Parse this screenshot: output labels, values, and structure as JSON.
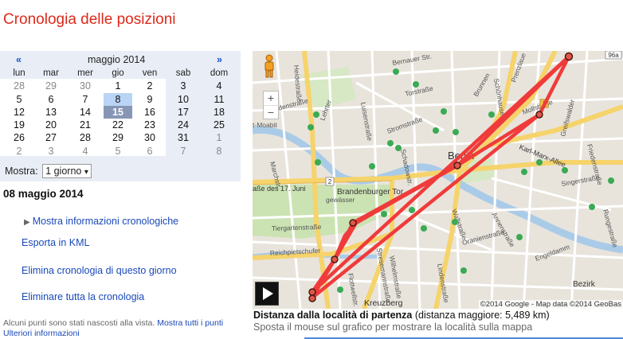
{
  "page": {
    "title": "Cronologia delle posizioni"
  },
  "calendar": {
    "prev": "«",
    "next": "»",
    "month": "maggio 2014",
    "weekdays": [
      "lun",
      "mar",
      "mer",
      "gio",
      "ven",
      "sab",
      "dom"
    ],
    "weeks": [
      [
        "28",
        "29",
        "30",
        "1",
        "2",
        "3",
        "4"
      ],
      [
        "5",
        "6",
        "7",
        "8",
        "9",
        "10",
        "11"
      ],
      [
        "12",
        "13",
        "14",
        "15",
        "16",
        "17",
        "18"
      ],
      [
        "19",
        "20",
        "21",
        "22",
        "23",
        "24",
        "25"
      ],
      [
        "26",
        "27",
        "28",
        "29",
        "30",
        "31",
        "1"
      ],
      [
        "2",
        "3",
        "4",
        "5",
        "6",
        "7",
        "8"
      ]
    ],
    "selected_day": "8",
    "today": "15"
  },
  "mode": {
    "label": "Mostra:",
    "value": "1 giorno",
    "arrow": "▾"
  },
  "date_heading": "08 maggio 2014",
  "links": {
    "show_info": "Mostra informazioni cronologiche",
    "export_kml": "Esporta in KML",
    "delete_day": "Elimina cronologia di questo giorno",
    "delete_all": "Eliminare tutta la cronologia"
  },
  "footnote": {
    "text": "Alcuni punti sono stati nascosti alla vista.",
    "show_all": "Mostra tutti i punti",
    "more_info": "Ulteriori informazioni"
  },
  "map": {
    "copyright": "©2014 Google - Map data ©2014 GeoBas",
    "labels": {
      "berlin": "Berlin",
      "brandenburger_tor": "Brandenburger Tor",
      "str_17_juni": "aße des 17. Juni",
      "karl_marx": "Karl-Marx-Allee",
      "kreuzberg": "Kreuzberg",
      "luisenstrasse": "Luisenstraße",
      "torstrasse": "Torstraße",
      "prenzlauer": "Prenzlaue",
      "moabit": "t-Moabit",
      "bezirk": "Bezirk",
      "oranienstrasse": "Oranienstraße",
      "engeldamm": "Engeldamm",
      "annenstrasse": "Annenstraße",
      "tiergartenstrasse": "Tiergartenstraße",
      "reichpietschufer": "Reichpietschufer",
      "wilhelmstrasse": "Wilhelmstraße",
      "gewasser": "gewässer",
      "road_2": "2",
      "road_96a": "96a",
      "road_1": "1",
      "schonhauser": "Schönhauser",
      "friedenstrasse": "Friedenstraße",
      "singerstrasse": "Singerstraße",
      "stromstrasse": "Stromstraße",
      "greifswalder": "Greifswalder",
      "heidestrasse": "Heidestraße",
      "rungestrasse": "Rungestraße",
      "mollstrasse": "Mollstraße",
      "invalidenstr": "Invalidenstraße",
      "lehrter": "Lehrter",
      "bernauer": "Bernauer Str.",
      "wallstrasse": "Wallstraße",
      "lindenstrasse": "Lindenstraße",
      "brunnen": "Brunnen",
      "marchstr": "Marchstr.",
      "flottwellstr": "Flottwellstr.",
      "schadowstr": "Schadowstr.",
      "stresemann": "Stresemannstraße"
    }
  },
  "chart": {
    "title_bold": "Distanza dalla località di partenza",
    "title_rest": "(distanza maggiore: 5,489 km)",
    "hint": "Sposta il mouse sul grafico per mostrare la località sulla mappa"
  }
}
